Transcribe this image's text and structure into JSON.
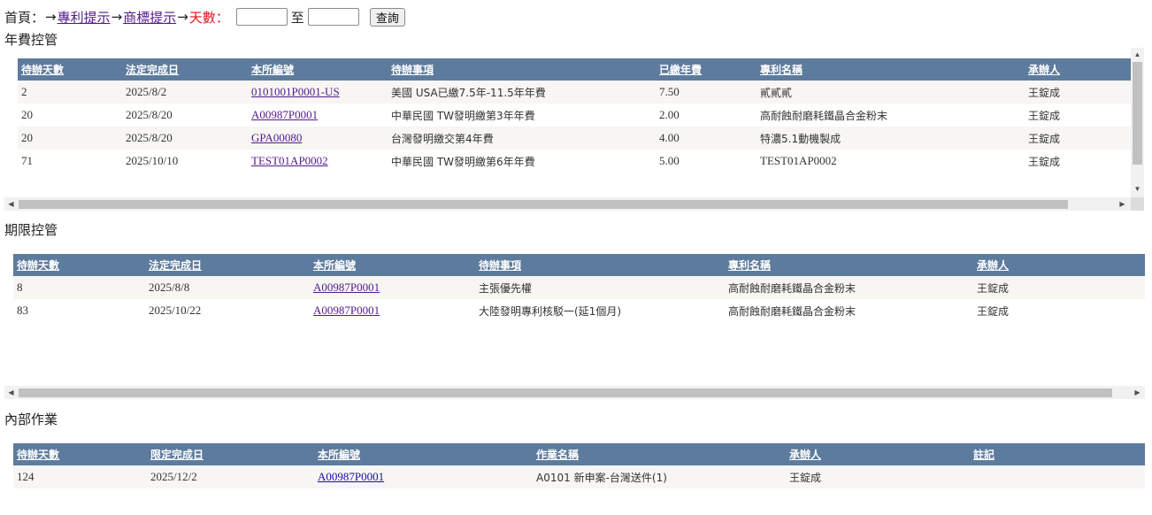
{
  "nav": {
    "home": "首頁：",
    "arrow": "→",
    "patent_link": "專利提示",
    "trademark_link": "商標提示",
    "days_label": "天數：",
    "to": "至",
    "query": "查詢"
  },
  "annual": {
    "title": "年費控管",
    "headers": [
      "待辦天數",
      "法定完成日",
      "本所編號",
      "待辦事項",
      "已繳年費",
      "專利名稱",
      "承辦人"
    ],
    "rows": [
      [
        "2",
        "2025/8/2",
        "0101001P0001-US",
        "美國 USA已繳7.5年-11.5年年費",
        "7.50",
        "貳貳貳",
        "王錠成"
      ],
      [
        "20",
        "2025/8/20",
        "A00987P0001",
        "中華民國 TW發明繳第3年年費",
        "2.00",
        "高耐蝕耐磨耗鐵晶合金粉末",
        "王錠成"
      ],
      [
        "20",
        "2025/8/20",
        "GPA00080",
        "台灣發明繳交第4年費",
        "4.00",
        "特濃5.1動機製成",
        "王錠成"
      ],
      [
        "71",
        "2025/10/10",
        "TEST01AP0002",
        "中華民國 TW發明繳第6年年費",
        "5.00",
        "TEST01AP0002",
        "王錠成"
      ]
    ]
  },
  "deadline": {
    "title": "期限控管",
    "headers": [
      "待辦天數",
      "法定完成日",
      "本所編號",
      "待辦事項",
      "專利名稱",
      "承辦人"
    ],
    "rows": [
      [
        "8",
        "2025/8/8",
        "A00987P0001",
        "主張優先權",
        "高耐蝕耐磨耗鐵晶合金粉末",
        "王錠成"
      ],
      [
        "83",
        "2025/10/22",
        "A00987P0001",
        "大陸發明專利核駁一(延1個月)",
        "高耐蝕耐磨耗鐵晶合金粉末",
        "王錠成"
      ]
    ]
  },
  "internal": {
    "title": "內部作業",
    "headers": [
      "待辦天數",
      "限定完成日",
      "本所編號",
      "作業名稱",
      "承辦人",
      "註記"
    ],
    "rows": [
      [
        "124",
        "2025/12/2",
        "A00987P0001",
        "A0101 新申案-台灣送件(1)",
        "王錠成",
        ""
      ]
    ]
  },
  "icons": {
    "left": "left-arrow-icon",
    "right": "right-arrow-icon",
    "up": "up-arrow-icon",
    "down": "down-arrow-icon"
  }
}
